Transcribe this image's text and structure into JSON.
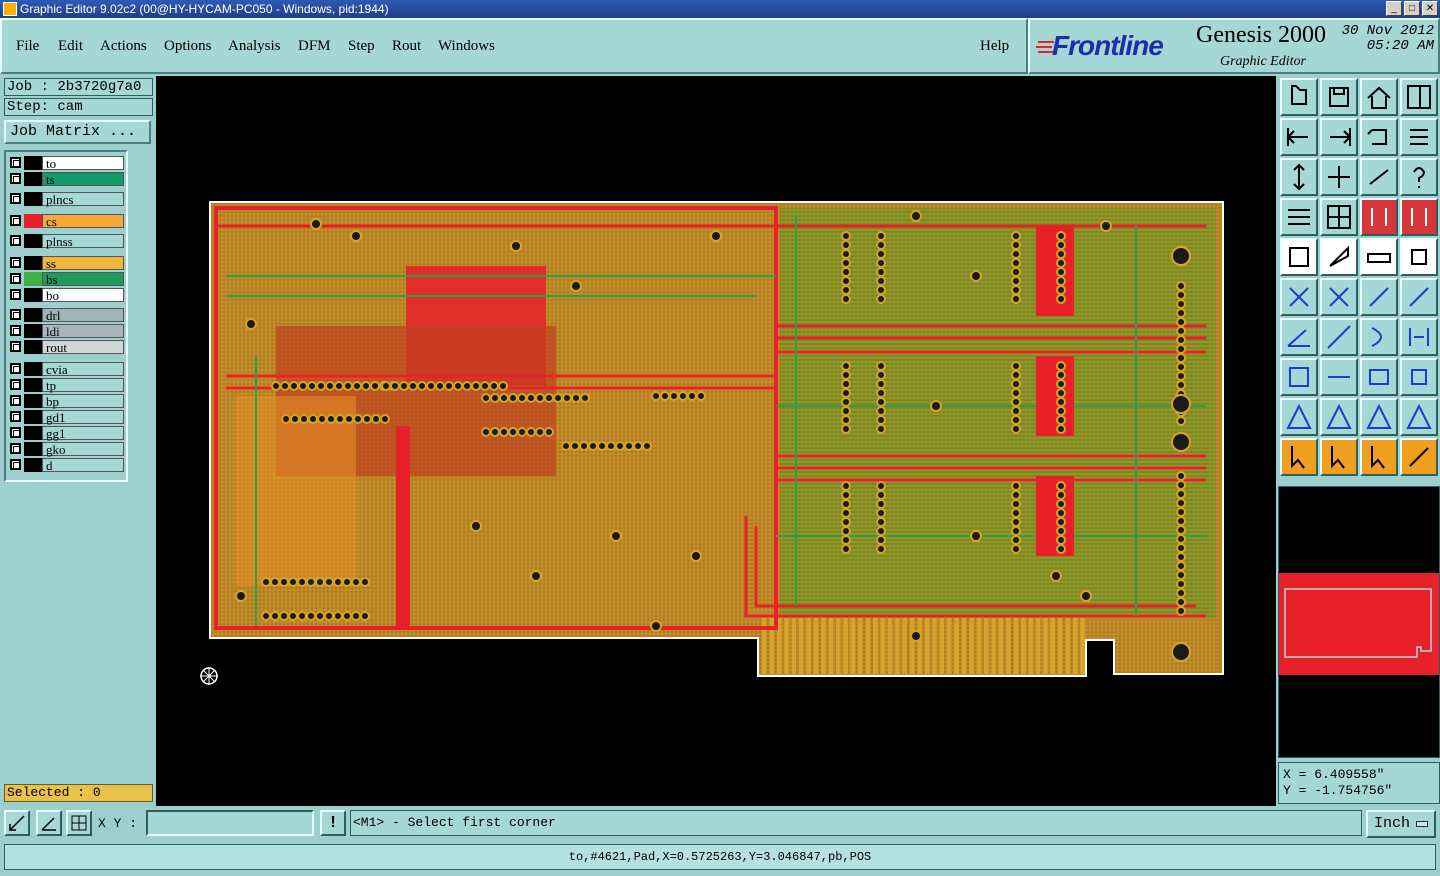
{
  "window": {
    "title": "Graphic Editor 9.02c2 (00@HY-HYCAM-PC050 - Windows, pid:1944)"
  },
  "menu": {
    "items": [
      "File",
      "Edit",
      "Actions",
      "Options",
      "Analysis",
      "DFM",
      "Step",
      "Rout",
      "Windows"
    ],
    "help": "Help"
  },
  "brand": {
    "logo": "Frontline",
    "product": "Genesis 2000",
    "subtitle": "Graphic Editor",
    "date": "30 Nov 2012",
    "time": "05:20 AM"
  },
  "job": {
    "job_label": "Job : 2b3720g7a0",
    "step_label": "Step: cam",
    "matrix_button": "Job Matrix ..."
  },
  "layers": [
    {
      "name": "to",
      "color": "#ffffff",
      "swatch": "#000000"
    },
    {
      "name": "ts",
      "color": "#139b6a",
      "swatch": "#000000"
    },
    {
      "name": "plncs",
      "color": "#a6d7d7",
      "swatch": "#000000"
    },
    {
      "name": "cs",
      "color": "#f6a93b",
      "swatch": "#e8202a",
      "active": true
    },
    {
      "name": "plnss",
      "color": "#a6d7d7",
      "swatch": "#000000"
    },
    {
      "name": "ss",
      "color": "#f2b53a",
      "swatch": "#000000"
    },
    {
      "name": "bs",
      "color": "#1f9a5b",
      "swatch": "#3cb043"
    },
    {
      "name": "bo",
      "color": "#ffffff",
      "swatch": "#000000"
    },
    {
      "name": "drl",
      "color": "#9fb4b8",
      "swatch": "#000000"
    },
    {
      "name": "ldi",
      "color": "#a8b6ba",
      "swatch": "#000000"
    },
    {
      "name": "rout",
      "color": "#cfd7d7",
      "swatch": "#000000"
    },
    {
      "name": "cvia",
      "color": "#a6d7d7",
      "swatch": "#000000"
    },
    {
      "name": "tp",
      "color": "#a6d7d7",
      "swatch": "#000000"
    },
    {
      "name": "bp",
      "color": "#a6d7d7",
      "swatch": "#000000"
    },
    {
      "name": "gd1",
      "color": "#a6d7d7",
      "swatch": "#000000"
    },
    {
      "name": "gg1",
      "color": "#a6d7d7",
      "swatch": "#000000"
    },
    {
      "name": "gko",
      "color": "#a6d7d7",
      "swatch": "#000000"
    },
    {
      "name": "d",
      "color": "#a6d7d7",
      "swatch": "#000000"
    }
  ],
  "selected_label": "Selected : 0",
  "coords": {
    "x_label": "X = 6.409558\"",
    "y_label": "Y = -1.754756\""
  },
  "command": {
    "xy_label": "X Y :",
    "xy_value": "",
    "info_button": "!",
    "prompt": "<M1> - Select first corner",
    "unit": "Inch"
  },
  "status": "to,#4621,Pad,X=0.5725263,Y=3.046847,pb,POS",
  "colors": {
    "copper_top": "#e8202a",
    "copper_bottom": "#2ea043",
    "silk": "#d4a52a",
    "board_edge": "#ffffff"
  }
}
